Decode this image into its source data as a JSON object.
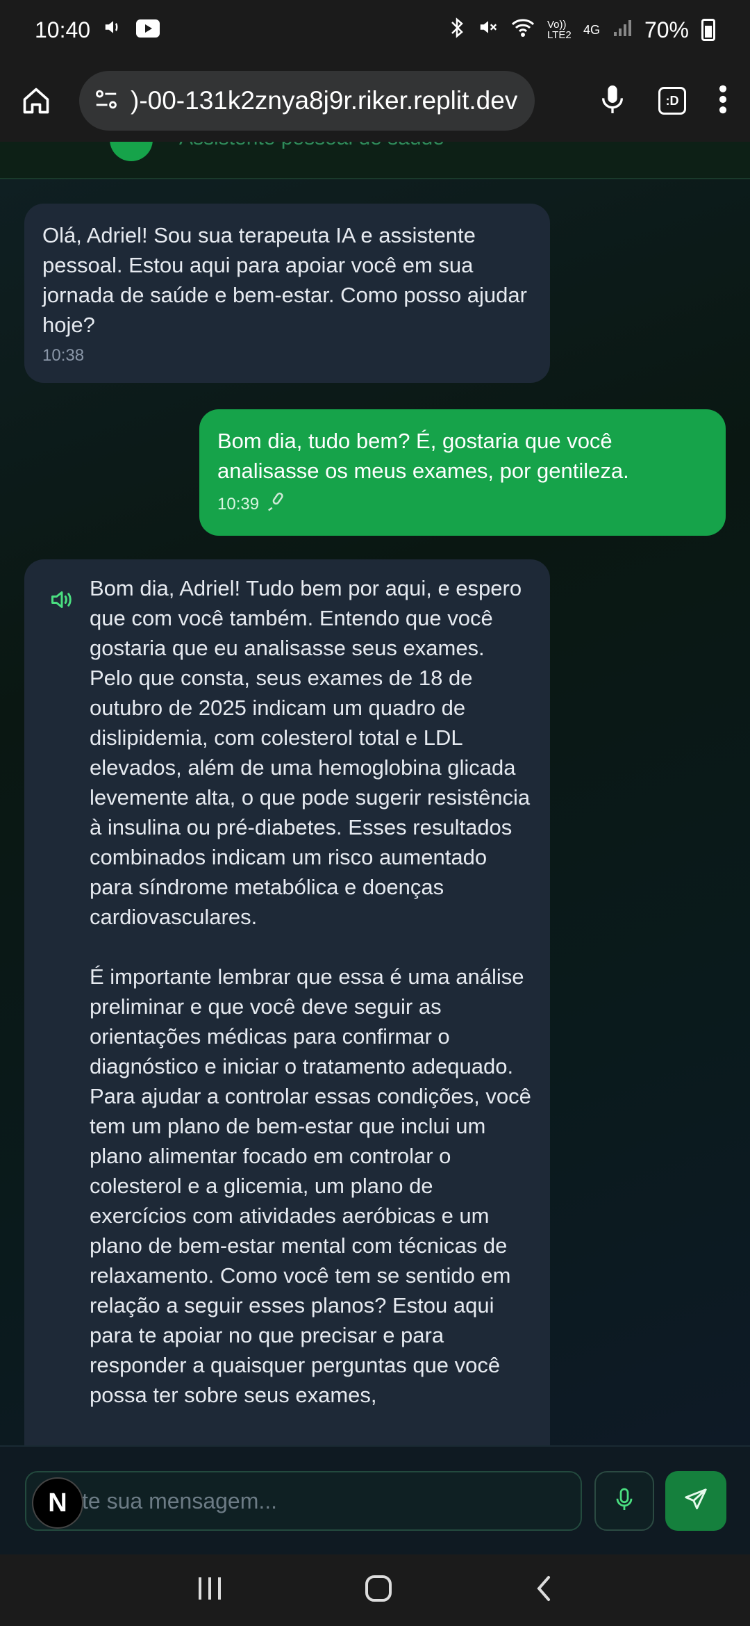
{
  "status_bar": {
    "time": "10:40",
    "network": "Vo)) LTE2",
    "signal_type": "4G",
    "battery": "70%"
  },
  "browser": {
    "url": ")-00-131k2znya8j9r.riker.replit.dev",
    "tab_indicator": ":D"
  },
  "header": {
    "subtitle": "Assistente pessoal de saúde"
  },
  "messages": [
    {
      "role": "assistant",
      "text": "Olá, Adriel! Sou sua terapeuta IA e assistente pessoal. Estou aqui para apoiar você em sua jornada de saúde e bem-estar. Como posso ajudar hoje?",
      "time": "10:38"
    },
    {
      "role": "user",
      "text": "Bom dia, tudo bem? É, gostaria que você analisasse os meus exames, por gentileza.",
      "time": "10:39"
    },
    {
      "role": "assistant",
      "paragraphs": [
        "Bom dia, Adriel! Tudo bem por aqui, e espero que com você também. Entendo que você gostaria que eu analisasse seus exames. Pelo que consta, seus exames de 18 de outubro de 2025 indicam um quadro de dislipidemia, com colesterol total e LDL elevados, além de uma hemoglobina glicada levemente alta, o que pode sugerir resistência à insulina ou pré-diabetes. Esses resultados combinados indicam um risco aumentado para síndrome metabólica e doenças cardiovasculares.",
        "É importante lembrar que essa é uma análise preliminar e que você deve seguir as orientações médicas para confirmar o diagnóstico e iniciar o tratamento adequado. Para ajudar a controlar essas condições, você tem um plano de bem-estar que inclui um plano alimentar focado em controlar o colesterol e a glicemia, um plano de exercícios com atividades aeróbicas e um plano de bem-estar mental com técnicas de relaxamento. Como você tem se sentido em relação a seguir esses planos? Estou aqui para te apoiar no que precisar e para responder a quaisquer perguntas que você possa ter sobre seus exames,"
      ]
    }
  ],
  "input": {
    "placeholder": "te sua mensagem...",
    "badge": "N"
  },
  "colors": {
    "accent": "#16a34a",
    "ai_bubble": "#1e2937",
    "user_bubble": "#16a34a"
  }
}
